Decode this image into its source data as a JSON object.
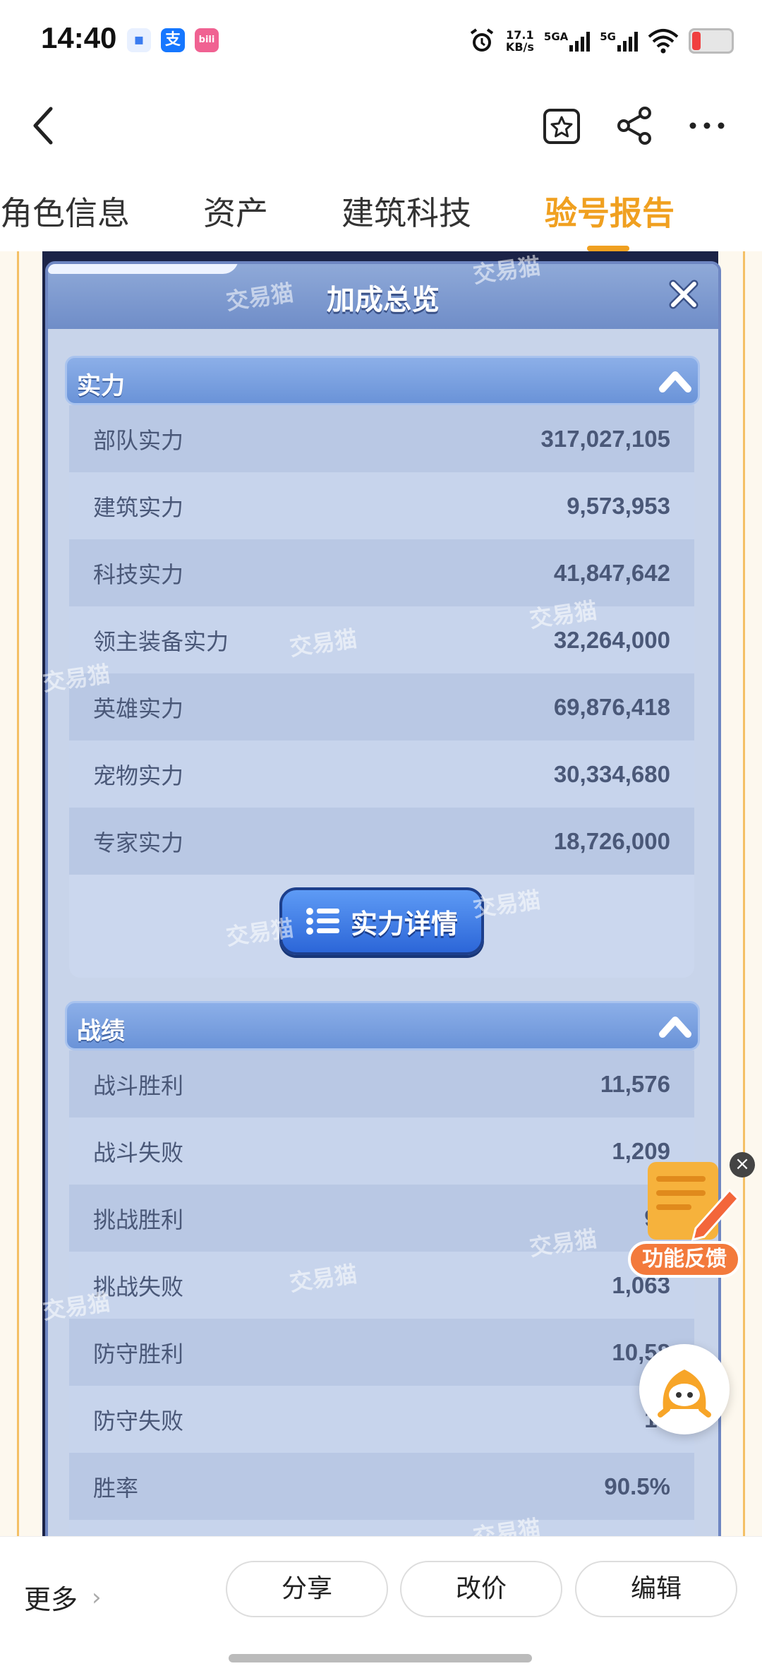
{
  "status_bar": {
    "time": "14:40",
    "net_speed_value": "17.1",
    "net_speed_unit": "KB/s",
    "signal1": "5GA",
    "signal2": "5G",
    "app_icon_2": "支",
    "app_icon_3": "bili"
  },
  "tabs": [
    {
      "label": "角色信息"
    },
    {
      "label": "资产"
    },
    {
      "label": "建筑科技"
    },
    {
      "label": "验号报告"
    }
  ],
  "panel": {
    "title": "加成总览",
    "watermark": "交易猫"
  },
  "strength": {
    "title": "实力",
    "rows": [
      {
        "label": "部队实力",
        "value": "317,027,105"
      },
      {
        "label": "建筑实力",
        "value": "9,573,953"
      },
      {
        "label": "科技实力",
        "value": "41,847,642"
      },
      {
        "label": "领主装备实力",
        "value": "32,264,000"
      },
      {
        "label": "英雄实力",
        "value": "69,876,418"
      },
      {
        "label": "宠物实力",
        "value": "30,334,680"
      },
      {
        "label": "专家实力",
        "value": "18,726,000"
      }
    ],
    "detail_button": "实力详情"
  },
  "record": {
    "title": "战绩",
    "rows": [
      {
        "label": "战斗胜利",
        "value": "11,576"
      },
      {
        "label": "战斗失败",
        "value": "1,209"
      },
      {
        "label": "挑战胜利",
        "value": "99"
      },
      {
        "label": "挑战失败",
        "value": "1,063"
      },
      {
        "label": "防守胜利",
        "value": "10,58"
      },
      {
        "label": "防守失败",
        "value": "14"
      },
      {
        "label": "胜率",
        "value": "90.5%"
      }
    ]
  },
  "feedback": {
    "label": "功能反馈"
  },
  "bottom_bar": {
    "more": "更多",
    "share": "分享",
    "reprice": "改价",
    "edit": "编辑"
  },
  "colors": {
    "accent": "#f0a020",
    "panel_bg": "#c8d4ea",
    "section_header": "#7a9fe0",
    "button_blue": "#2c66d8",
    "feedback_orange": "#f37a3c"
  }
}
